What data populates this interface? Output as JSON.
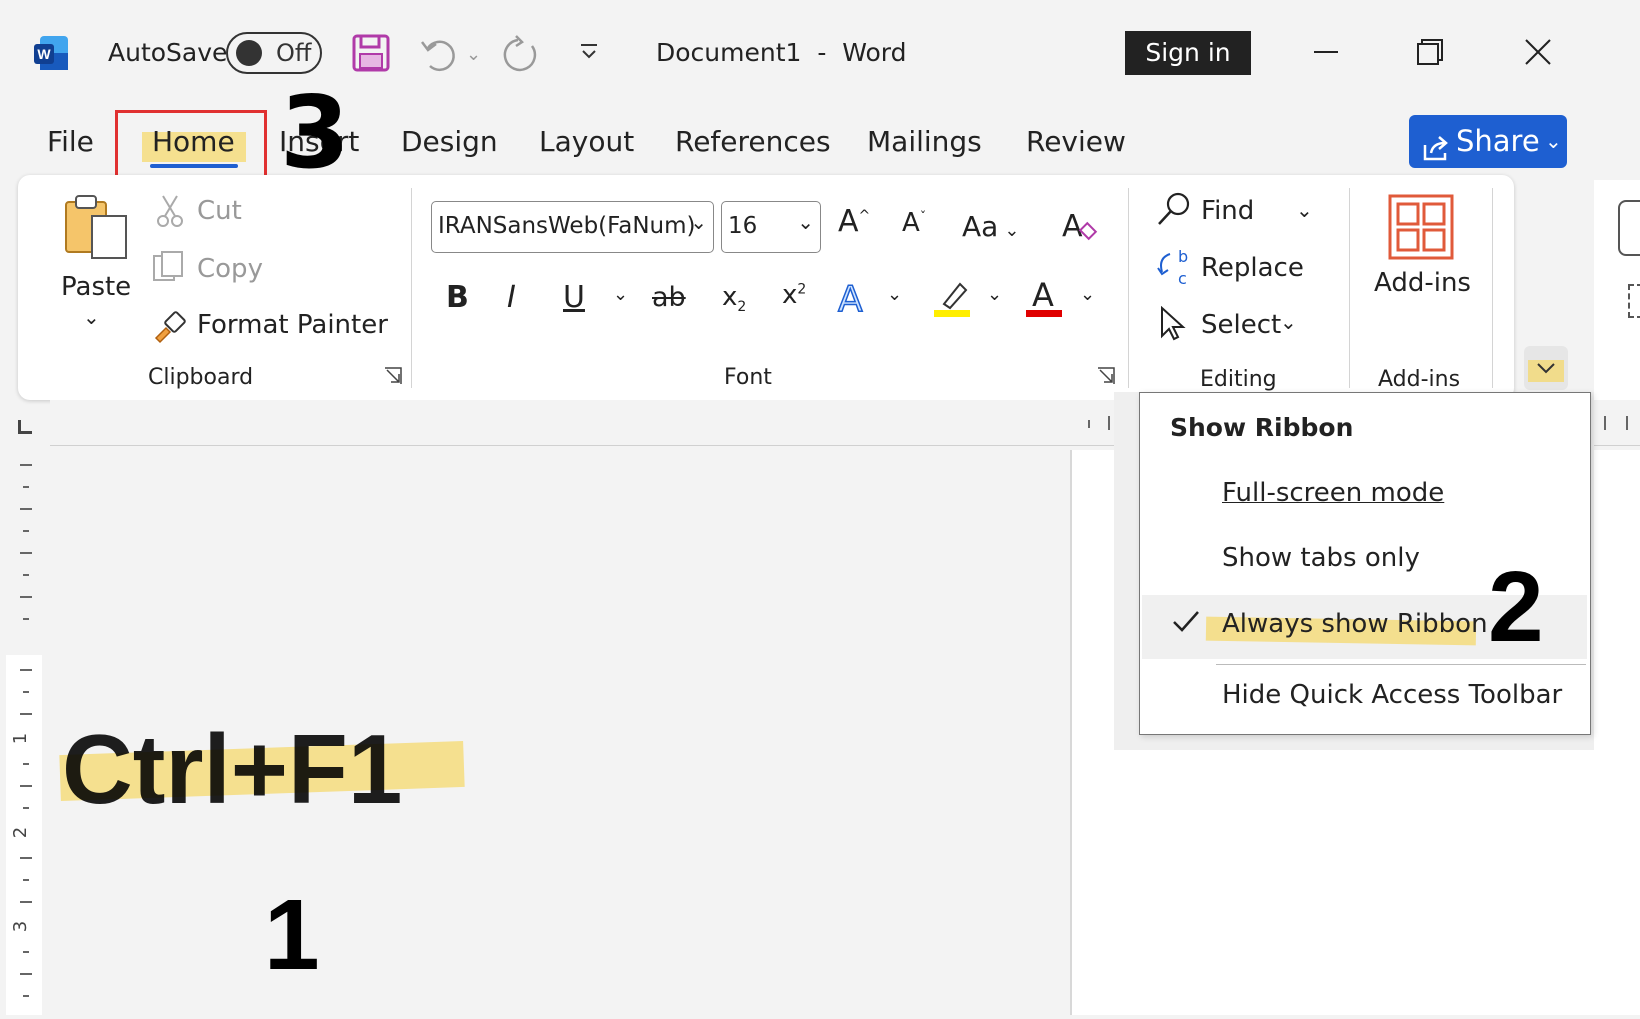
{
  "title_bar": {
    "app_icon_letter": "W",
    "autosave_label": "AutoSave",
    "autosave_state": "Off",
    "document_title": "Document1  -  Word",
    "sign_in": "Sign in"
  },
  "tabs": [
    "File",
    "Home",
    "Insert",
    "Design",
    "Layout",
    "References",
    "Mailings",
    "Review"
  ],
  "share_button": "Share",
  "clipboard": {
    "paste": "Paste",
    "cut": "Cut",
    "copy": "Copy",
    "format_painter": "Format Painter",
    "group_label": "Clipboard"
  },
  "font": {
    "font_name": "IRANSansWeb(FaNum)",
    "font_size": "16",
    "change_case": "Aa",
    "group_label": "Font"
  },
  "editing": {
    "find": "Find",
    "replace": "Replace",
    "select": "Select",
    "group_label": "Editing"
  },
  "addins": {
    "button": "Add-ins",
    "group_label": "Add-ins"
  },
  "ribbon_menu": {
    "title": "Show Ribbon",
    "items": [
      "Full-screen mode",
      "Show tabs only",
      "Always show Ribbon",
      "Hide Quick Access Toolbar"
    ],
    "checked_item": "Always show Ribbon"
  },
  "annotations": {
    "shortcut": "Ctrl+F1",
    "step1": "1",
    "step2": "2",
    "step3": "3"
  },
  "ruler_numbers": [
    "1",
    "2",
    "3"
  ],
  "colors": {
    "accent": "#1e5fd1",
    "highlight": "#f5d764",
    "home_box": "#e03030",
    "font_color_bar": "#e00000",
    "highlighter_bar": "#ffee00"
  }
}
